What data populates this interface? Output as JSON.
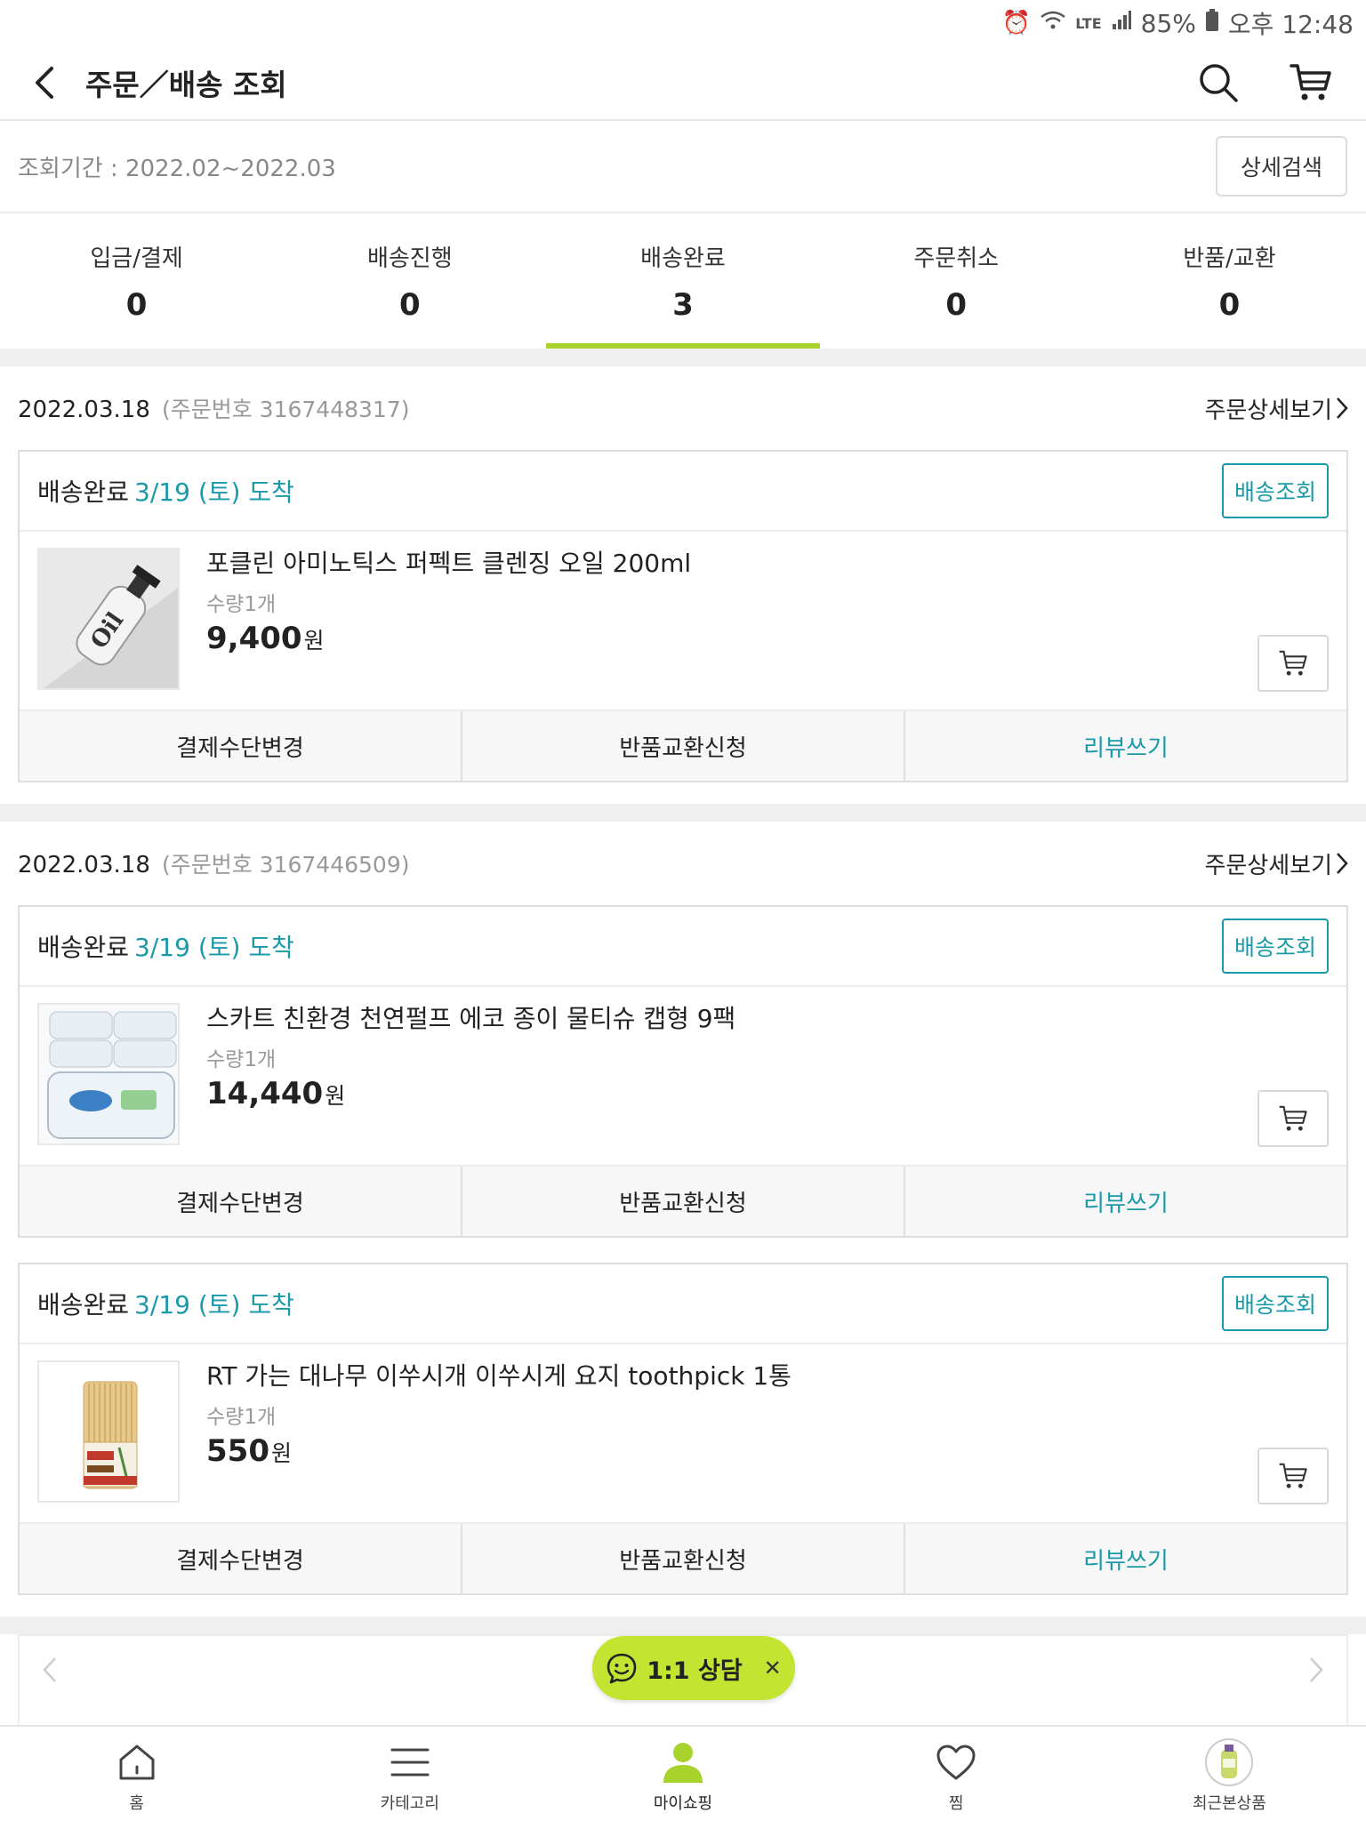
{
  "status_bar": {
    "battery": "85%",
    "time": "오후 12:48",
    "network": "LTE"
  },
  "header": {
    "title": "주문／배송 조회"
  },
  "period": {
    "text": "조회기간 : 2022.02~2022.03",
    "detail_search_label": "상세검색"
  },
  "status_tabs": [
    {
      "label": "입금/결제",
      "count": "0"
    },
    {
      "label": "배송진행",
      "count": "0"
    },
    {
      "label": "배송완료",
      "count": "3"
    },
    {
      "label": "주문취소",
      "count": "0"
    },
    {
      "label": "반품/교환",
      "count": "0"
    }
  ],
  "active_tab_index": 2,
  "orders": [
    {
      "date": "2022.03.18",
      "order_no": "(주문번호 3167448317)",
      "detail_link": "주문상세보기",
      "items": [
        {
          "status": "배송완료",
          "arrival": "3/19 (토) 도착",
          "track_label": "배송조회",
          "name": "포클린 아미노틱스 퍼펙트 클렌징 오일 200ml",
          "qty": "수량1개",
          "price": "9,400",
          "currency": "원",
          "actions": [
            "결제수단변경",
            "반품교환신청",
            "리뷰쓰기"
          ]
        }
      ]
    },
    {
      "date": "2022.03.18",
      "order_no": "(주문번호 3167446509)",
      "detail_link": "주문상세보기",
      "items": [
        {
          "status": "배송완료",
          "arrival": "3/19 (토) 도착",
          "track_label": "배송조회",
          "name": "스카트 친환경 천연펄프 에코 종이 물티슈 캡형 9팩",
          "qty": "수량1개",
          "price": "14,440",
          "currency": "원",
          "actions": [
            "결제수단변경",
            "반품교환신청",
            "리뷰쓰기"
          ]
        },
        {
          "status": "배송완료",
          "arrival": "3/19 (토) 도착",
          "track_label": "배송조회",
          "name": "RT 가는 대나무 이쑤시개 이쑤시게 요지 toothpick 1통",
          "qty": "수량1개",
          "price": "550",
          "currency": "원",
          "actions": [
            "결제수단변경",
            "반품교환신청",
            "리뷰쓰기"
          ]
        }
      ]
    }
  ],
  "chat": {
    "label": "1:1 상담"
  },
  "bottom_nav": [
    {
      "label": "홈",
      "icon": "home-icon"
    },
    {
      "label": "카테고리",
      "icon": "menu-icon"
    },
    {
      "label": "마이쇼핑",
      "icon": "person-icon"
    },
    {
      "label": "찜",
      "icon": "heart-icon"
    },
    {
      "label": "최근본상품",
      "icon": "recent-product-icon"
    }
  ],
  "colors": {
    "accent_green": "#a7d32c",
    "chat_green": "#c4e432",
    "teal": "#1a9aa8"
  }
}
